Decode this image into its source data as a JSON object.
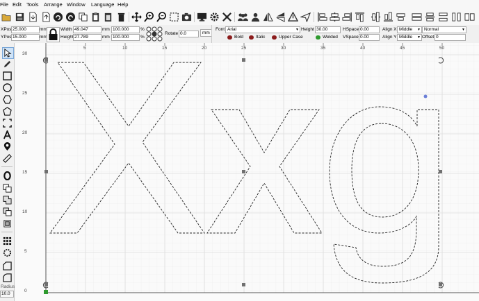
{
  "menu": [
    "File",
    "Edit",
    "Tools",
    "Arrange",
    "Window",
    "Language",
    "Help"
  ],
  "props": {
    "xpos_label": "XPos",
    "xpos_value": "25.000",
    "xpos_unit": "mm",
    "ypos_label": "YPos",
    "ypos_value": "15.000",
    "ypos_unit": "mm",
    "width_label": "Width",
    "width_value": "49.047",
    "width_unit": "mm",
    "width_pct": "100.000",
    "width_pct_sym": "%",
    "height_label": "Height",
    "height_value": "27.789",
    "height_unit": "mm",
    "height_pct": "100.000",
    "height_pct_sym": "%",
    "rotate_label": "Rotate",
    "rotate_value": "0.0",
    "rotate_unit": "mm"
  },
  "text_props": {
    "font_label": "Font",
    "font_value": "Arial",
    "height_label": "Height",
    "height_value": "30.00",
    "hspace_label": "HSpace",
    "hspace_value": "0.00",
    "vspace_label": "VSpace",
    "vspace_value": "0.00",
    "alignx_label": "Align X",
    "alignx_value": "Middle",
    "aligny_label": "Align Y",
    "aligny_value": "Middle",
    "style_value": "Normal",
    "offset_label": "Offset",
    "offset_value": "0",
    "bold_label": "Bold",
    "italic_label": "Italic",
    "upper_label": "Upper Case",
    "welded_label": "Welded"
  },
  "left_footer": {
    "radius_label": "Radius:",
    "radius_value": "10.0"
  },
  "ruler": {
    "top": [
      "5",
      "10",
      "15",
      "20",
      "25",
      "30",
      "35",
      "40",
      "45",
      "50"
    ],
    "left": [
      "30",
      "25",
      "20",
      "15",
      "10",
      "5",
      "0"
    ]
  },
  "colors": {
    "selection_handle": "#707070",
    "anchor_dot": "#6b7fd7",
    "origin": "#2e9a2e"
  }
}
